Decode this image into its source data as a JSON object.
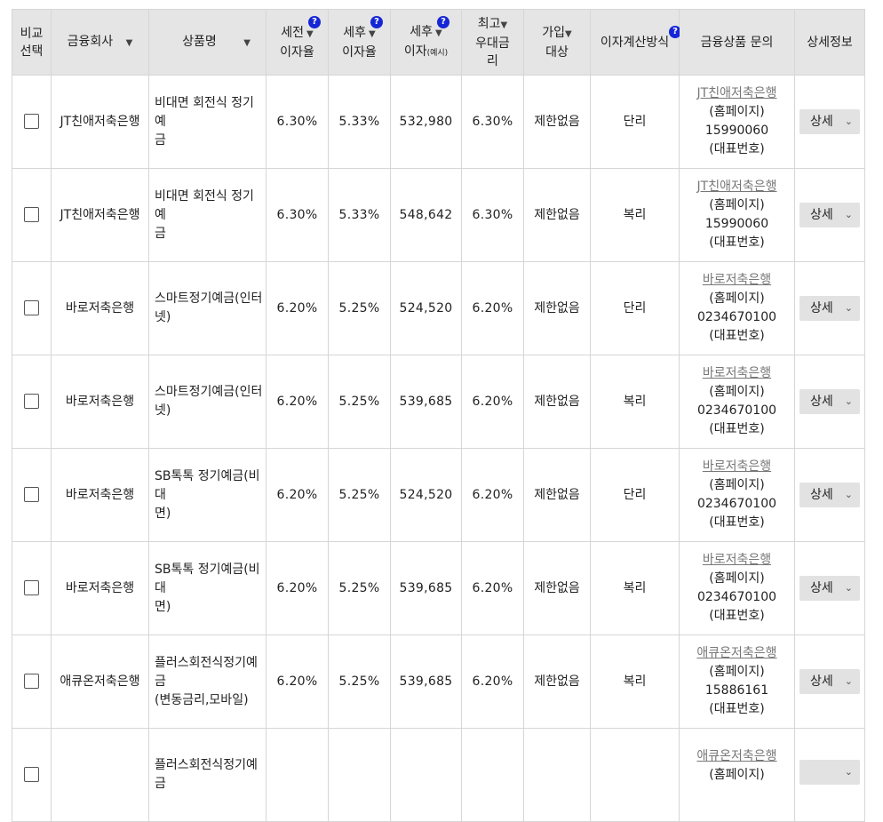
{
  "headers": {
    "compare_line1": "비교",
    "compare_line2": "선택",
    "company": "금융회사",
    "product": "상품명",
    "pre_tax_line1": "세전",
    "pre_tax_line2": "이자율",
    "after_tax_line1": "세후",
    "after_tax_line2": "이자율",
    "after_interest_line1": "세후",
    "after_interest_line2": "이자",
    "after_interest_note": "(예시)",
    "max_rate_line1": "최고",
    "max_rate_line2": "우대금",
    "max_rate_line3": "리",
    "join_line1": "가입",
    "join_line2": "대상",
    "calc_method": "이자계산방식",
    "inquiry": "금융상품 문의",
    "detail": "상세정보",
    "sort_icon": "▼",
    "help_icon": "?"
  },
  "rows": [
    {
      "company": "JT친애저축은행",
      "product_line1": "비대면 회전식 정기예",
      "product_line2": "금",
      "pre_tax": "6.30%",
      "after_tax": "5.33%",
      "after_interest": "532,980",
      "max_rate": "6.30%",
      "join": "제한없음",
      "calc": "단리",
      "inq_link": "JT친애저축은행",
      "inq_home": "(홈페이지)",
      "inq_phone": "15990060",
      "inq_rep": "(대표번호)",
      "detail_label": "상세"
    },
    {
      "company": "JT친애저축은행",
      "product_line1": "비대면 회전식 정기예",
      "product_line2": "금",
      "pre_tax": "6.30%",
      "after_tax": "5.33%",
      "after_interest": "548,642",
      "max_rate": "6.30%",
      "join": "제한없음",
      "calc": "복리",
      "inq_link": "JT친애저축은행",
      "inq_home": "(홈페이지)",
      "inq_phone": "15990060",
      "inq_rep": "(대표번호)",
      "detail_label": "상세"
    },
    {
      "company": "바로저축은행",
      "product_line1": "스마트정기예금(인터",
      "product_line2": "넷)",
      "pre_tax": "6.20%",
      "after_tax": "5.25%",
      "after_interest": "524,520",
      "max_rate": "6.20%",
      "join": "제한없음",
      "calc": "단리",
      "inq_link": "바로저축은행",
      "inq_home": "(홈페이지)",
      "inq_phone": "0234670100",
      "inq_rep": "(대표번호)",
      "detail_label": "상세"
    },
    {
      "company": "바로저축은행",
      "product_line1": "스마트정기예금(인터",
      "product_line2": "넷)",
      "pre_tax": "6.20%",
      "after_tax": "5.25%",
      "after_interest": "539,685",
      "max_rate": "6.20%",
      "join": "제한없음",
      "calc": "복리",
      "inq_link": "바로저축은행",
      "inq_home": "(홈페이지)",
      "inq_phone": "0234670100",
      "inq_rep": "(대표번호)",
      "detail_label": "상세"
    },
    {
      "company": "바로저축은행",
      "product_line1": "SB톡톡 정기예금(비대",
      "product_line2": "면)",
      "pre_tax": "6.20%",
      "after_tax": "5.25%",
      "after_interest": "524,520",
      "max_rate": "6.20%",
      "join": "제한없음",
      "calc": "단리",
      "inq_link": "바로저축은행",
      "inq_home": "(홈페이지)",
      "inq_phone": "0234670100",
      "inq_rep": "(대표번호)",
      "detail_label": "상세"
    },
    {
      "company": "바로저축은행",
      "product_line1": "SB톡톡 정기예금(비대",
      "product_line2": "면)",
      "pre_tax": "6.20%",
      "after_tax": "5.25%",
      "after_interest": "539,685",
      "max_rate": "6.20%",
      "join": "제한없음",
      "calc": "복리",
      "inq_link": "바로저축은행",
      "inq_home": "(홈페이지)",
      "inq_phone": "0234670100",
      "inq_rep": "(대표번호)",
      "detail_label": "상세"
    },
    {
      "company": "애큐온저축은행",
      "product_line1": "플러스회전식정기예금",
      "product_line2": "(변동금리,모바일)",
      "pre_tax": "6.20%",
      "after_tax": "5.25%",
      "after_interest": "539,685",
      "max_rate": "6.20%",
      "join": "제한없음",
      "calc": "복리",
      "inq_link": "애큐온저축은행",
      "inq_home": "(홈페이지)",
      "inq_phone": "15886161",
      "inq_rep": "(대표번호)",
      "detail_label": "상세"
    },
    {
      "company": "",
      "product_line1": "플러스회전식정기예금",
      "product_line2": "",
      "pre_tax": "",
      "after_tax": "",
      "after_interest": "",
      "max_rate": "",
      "join": "",
      "calc": "",
      "inq_link": "애큐온저축은행",
      "inq_home": "(홈페이지)",
      "inq_phone": "",
      "inq_rep": "",
      "detail_label": ""
    }
  ]
}
